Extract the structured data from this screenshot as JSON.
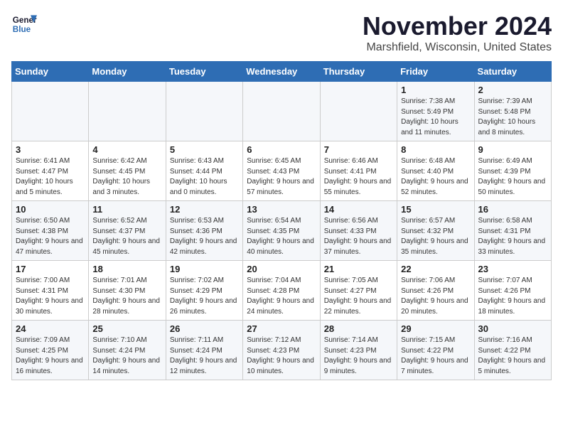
{
  "logo": {
    "line1": "General",
    "line2": "Blue"
  },
  "title": "November 2024",
  "location": "Marshfield, Wisconsin, United States",
  "days_header": [
    "Sunday",
    "Monday",
    "Tuesday",
    "Wednesday",
    "Thursday",
    "Friday",
    "Saturday"
  ],
  "weeks": [
    [
      {
        "day": "",
        "info": ""
      },
      {
        "day": "",
        "info": ""
      },
      {
        "day": "",
        "info": ""
      },
      {
        "day": "",
        "info": ""
      },
      {
        "day": "",
        "info": ""
      },
      {
        "day": "1",
        "info": "Sunrise: 7:38 AM\nSunset: 5:49 PM\nDaylight: 10 hours and 11 minutes."
      },
      {
        "day": "2",
        "info": "Sunrise: 7:39 AM\nSunset: 5:48 PM\nDaylight: 10 hours and 8 minutes."
      }
    ],
    [
      {
        "day": "3",
        "info": "Sunrise: 6:41 AM\nSunset: 4:47 PM\nDaylight: 10 hours and 5 minutes."
      },
      {
        "day": "4",
        "info": "Sunrise: 6:42 AM\nSunset: 4:45 PM\nDaylight: 10 hours and 3 minutes."
      },
      {
        "day": "5",
        "info": "Sunrise: 6:43 AM\nSunset: 4:44 PM\nDaylight: 10 hours and 0 minutes."
      },
      {
        "day": "6",
        "info": "Sunrise: 6:45 AM\nSunset: 4:43 PM\nDaylight: 9 hours and 57 minutes."
      },
      {
        "day": "7",
        "info": "Sunrise: 6:46 AM\nSunset: 4:41 PM\nDaylight: 9 hours and 55 minutes."
      },
      {
        "day": "8",
        "info": "Sunrise: 6:48 AM\nSunset: 4:40 PM\nDaylight: 9 hours and 52 minutes."
      },
      {
        "day": "9",
        "info": "Sunrise: 6:49 AM\nSunset: 4:39 PM\nDaylight: 9 hours and 50 minutes."
      }
    ],
    [
      {
        "day": "10",
        "info": "Sunrise: 6:50 AM\nSunset: 4:38 PM\nDaylight: 9 hours and 47 minutes."
      },
      {
        "day": "11",
        "info": "Sunrise: 6:52 AM\nSunset: 4:37 PM\nDaylight: 9 hours and 45 minutes."
      },
      {
        "day": "12",
        "info": "Sunrise: 6:53 AM\nSunset: 4:36 PM\nDaylight: 9 hours and 42 minutes."
      },
      {
        "day": "13",
        "info": "Sunrise: 6:54 AM\nSunset: 4:35 PM\nDaylight: 9 hours and 40 minutes."
      },
      {
        "day": "14",
        "info": "Sunrise: 6:56 AM\nSunset: 4:33 PM\nDaylight: 9 hours and 37 minutes."
      },
      {
        "day": "15",
        "info": "Sunrise: 6:57 AM\nSunset: 4:32 PM\nDaylight: 9 hours and 35 minutes."
      },
      {
        "day": "16",
        "info": "Sunrise: 6:58 AM\nSunset: 4:31 PM\nDaylight: 9 hours and 33 minutes."
      }
    ],
    [
      {
        "day": "17",
        "info": "Sunrise: 7:00 AM\nSunset: 4:31 PM\nDaylight: 9 hours and 30 minutes."
      },
      {
        "day": "18",
        "info": "Sunrise: 7:01 AM\nSunset: 4:30 PM\nDaylight: 9 hours and 28 minutes."
      },
      {
        "day": "19",
        "info": "Sunrise: 7:02 AM\nSunset: 4:29 PM\nDaylight: 9 hours and 26 minutes."
      },
      {
        "day": "20",
        "info": "Sunrise: 7:04 AM\nSunset: 4:28 PM\nDaylight: 9 hours and 24 minutes."
      },
      {
        "day": "21",
        "info": "Sunrise: 7:05 AM\nSunset: 4:27 PM\nDaylight: 9 hours and 22 minutes."
      },
      {
        "day": "22",
        "info": "Sunrise: 7:06 AM\nSunset: 4:26 PM\nDaylight: 9 hours and 20 minutes."
      },
      {
        "day": "23",
        "info": "Sunrise: 7:07 AM\nSunset: 4:26 PM\nDaylight: 9 hours and 18 minutes."
      }
    ],
    [
      {
        "day": "24",
        "info": "Sunrise: 7:09 AM\nSunset: 4:25 PM\nDaylight: 9 hours and 16 minutes."
      },
      {
        "day": "25",
        "info": "Sunrise: 7:10 AM\nSunset: 4:24 PM\nDaylight: 9 hours and 14 minutes."
      },
      {
        "day": "26",
        "info": "Sunrise: 7:11 AM\nSunset: 4:24 PM\nDaylight: 9 hours and 12 minutes."
      },
      {
        "day": "27",
        "info": "Sunrise: 7:12 AM\nSunset: 4:23 PM\nDaylight: 9 hours and 10 minutes."
      },
      {
        "day": "28",
        "info": "Sunrise: 7:14 AM\nSunset: 4:23 PM\nDaylight: 9 hours and 9 minutes."
      },
      {
        "day": "29",
        "info": "Sunrise: 7:15 AM\nSunset: 4:22 PM\nDaylight: 9 hours and 7 minutes."
      },
      {
        "day": "30",
        "info": "Sunrise: 7:16 AM\nSunset: 4:22 PM\nDaylight: 9 hours and 5 minutes."
      }
    ]
  ]
}
